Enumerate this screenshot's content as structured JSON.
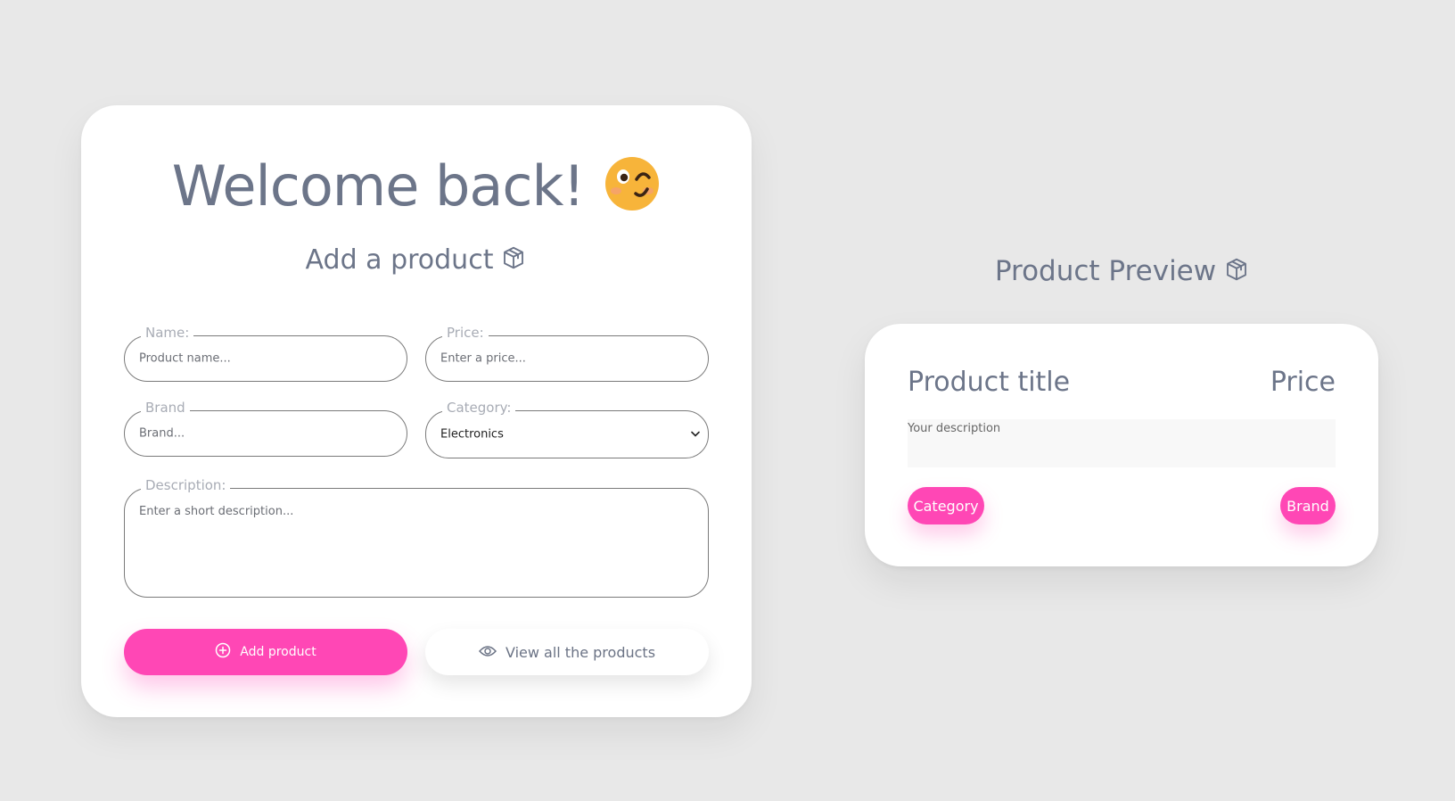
{
  "form": {
    "welcome": "Welcome back!",
    "subtitle": "Add a product",
    "name": {
      "label": "Name:",
      "placeholder": "Product name..."
    },
    "price": {
      "label": "Price:",
      "placeholder": "Enter a price..."
    },
    "brand": {
      "label": "Brand",
      "placeholder": "Brand..."
    },
    "category": {
      "label": "Category:",
      "value": "Electronics"
    },
    "description": {
      "label": "Description:",
      "placeholder": "Enter a short description..."
    },
    "add_button": "Add product",
    "view_button": "View all the products"
  },
  "preview": {
    "heading": "Product Preview",
    "title": "Product title",
    "price": "Price",
    "description": "Your description",
    "category": "Category",
    "brand": "Brand"
  },
  "colors": {
    "accent": "#ff47b5",
    "text": "#6c7589",
    "background": "#e8e8e8",
    "card": "#ffffff"
  },
  "icons": {
    "welcome_emoji": "winking-face-icon",
    "subtitle": "package-icon",
    "add_button": "plus-circle-icon",
    "view_button": "eye-icon",
    "category_select": "chevron-down-icon"
  }
}
